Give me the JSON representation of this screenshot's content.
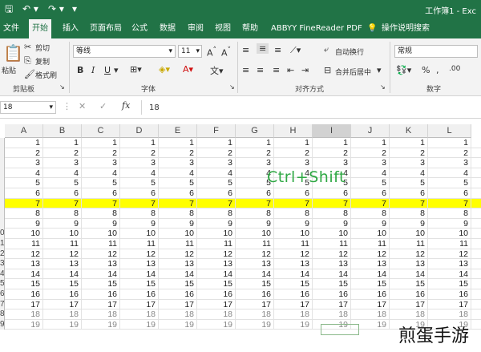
{
  "titlebar": {
    "title": "工作簿1 - Exc",
    "qa_icons": [
      "save-icon",
      "undo-icon",
      "redo-icon",
      "customize-icon"
    ]
  },
  "tabs": [
    "文件",
    "开始",
    "插入",
    "页面布局",
    "公式",
    "数据",
    "审阅",
    "视图",
    "帮助",
    "ABBYY FineReader PDF",
    "操作说明搜索"
  ],
  "ribbon": {
    "clipboard": {
      "paste": "粘贴",
      "cut": "剪切",
      "copy": "复制",
      "format_painter": "格式刷",
      "label": "剪贴板"
    },
    "font": {
      "name": "等线",
      "size": "11",
      "label": "字体"
    },
    "alignment": {
      "wrap": "自动换行",
      "merge": "合并后居中",
      "label": "对齐方式"
    },
    "number": {
      "format": "常规",
      "label": "数字"
    }
  },
  "formula_bar": {
    "name_box": "18",
    "formula": "18"
  },
  "grid": {
    "columns": [
      "A",
      "B",
      "C",
      "D",
      "E",
      "F",
      "G",
      "H",
      "I",
      "J",
      "K",
      "L"
    ],
    "row_numbers": [
      "",
      "",
      "",
      "",
      "",
      "",
      "",
      "",
      "",
      "0",
      "1",
      "2",
      "3",
      "4",
      "5",
      "6",
      "7",
      "8",
      "9"
    ],
    "rows": [
      [
        1,
        1,
        1,
        1,
        1,
        1,
        1,
        1,
        1,
        1,
        1,
        1
      ],
      [
        2,
        2,
        2,
        2,
        2,
        2,
        2,
        2,
        2,
        2,
        2,
        2
      ],
      [
        3,
        3,
        3,
        3,
        3,
        3,
        3,
        3,
        3,
        3,
        3,
        3
      ],
      [
        4,
        4,
        4,
        4,
        4,
        4,
        4,
        4,
        4,
        4,
        4,
        4
      ],
      [
        5,
        5,
        5,
        5,
        5,
        5,
        5,
        5,
        5,
        5,
        5,
        5
      ],
      [
        6,
        6,
        6,
        6,
        6,
        6,
        6,
        6,
        6,
        6,
        6,
        6
      ],
      [
        7,
        7,
        7,
        7,
        7,
        7,
        7,
        7,
        7,
        7,
        7,
        7
      ],
      [
        8,
        8,
        8,
        8,
        8,
        8,
        8,
        8,
        8,
        8,
        8,
        8
      ],
      [
        9,
        9,
        9,
        9,
        9,
        9,
        9,
        9,
        9,
        9,
        9,
        9
      ],
      [
        10,
        10,
        10,
        10,
        10,
        10,
        10,
        10,
        10,
        10,
        10,
        10
      ],
      [
        11,
        11,
        11,
        11,
        11,
        11,
        11,
        11,
        11,
        11,
        11,
        11
      ],
      [
        12,
        12,
        12,
        12,
        12,
        12,
        12,
        12,
        12,
        12,
        12,
        12
      ],
      [
        13,
        13,
        13,
        13,
        13,
        13,
        13,
        13,
        13,
        13,
        13,
        13
      ],
      [
        14,
        14,
        14,
        14,
        14,
        14,
        14,
        14,
        14,
        14,
        14,
        14
      ],
      [
        15,
        15,
        15,
        15,
        15,
        15,
        15,
        15,
        15,
        15,
        15,
        15
      ],
      [
        16,
        16,
        16,
        16,
        16,
        16,
        16,
        16,
        16,
        16,
        16,
        16
      ],
      [
        17,
        17,
        17,
        17,
        17,
        17,
        17,
        17,
        17,
        17,
        17,
        17
      ],
      [
        18,
        18,
        18,
        18,
        18,
        18,
        18,
        18,
        18,
        18,
        18,
        18
      ],
      [
        19,
        19,
        19,
        19,
        19,
        19,
        19,
        19,
        19,
        19,
        19,
        19
      ]
    ],
    "highlight_row_index": 6,
    "highlight_color": "#ffff00"
  },
  "overlay": {
    "shortcut": "Ctrl+Shift",
    "watermark": "煎蛋手游"
  },
  "colors": {
    "accent": "#217346",
    "overlay_text": "#2fa844"
  }
}
